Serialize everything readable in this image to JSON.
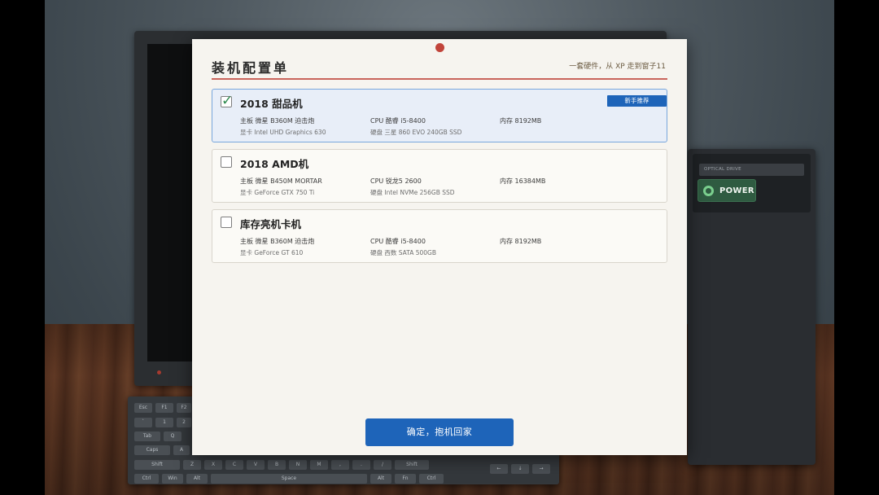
{
  "dialog": {
    "title": "装机配置单",
    "subtitle": "一套硬件，从 XP 走到窗子11",
    "confirm_label": "确定，抱机回家"
  },
  "configs": [
    {
      "name": "2018 甜品机",
      "selected": true,
      "badge": "新手推荐",
      "motherboard": "主板 微星 B360M 迫击炮",
      "gpu": "显卡 Intel UHD Graphics 630",
      "cpu": "CPU 酷睿 i5-8400",
      "disk": "硬盘 三星 860 EVO 240GB SSD",
      "memory": "内存 8192MB"
    },
    {
      "name": "2018 AMD机",
      "selected": false,
      "motherboard": "主板 微星 B450M MORTAR",
      "gpu": "显卡 GeForce GTX 750 Ti",
      "cpu": "CPU 锐龙5 2600",
      "disk": "硬盘 Intel NVMe 256GB SSD",
      "memory": "内存 16384MB"
    },
    {
      "name": "库存亮机卡机",
      "selected": false,
      "motherboard": "主板 微星 B360M 迫击炮",
      "gpu": "显卡 GeForce GT 610",
      "cpu": "CPU 酷睿 i5-8400",
      "disk": "硬盘 西数 SATA 500GB",
      "memory": "内存 8192MB"
    }
  ],
  "tower": {
    "optical_label": "OPTICAL DRIVE",
    "power_label": "POWER"
  },
  "keyboard": {
    "keys": [
      "Esc",
      "F1",
      "F2",
      "`",
      "1",
      "2",
      "Tab",
      "Q",
      "Caps",
      "A",
      "Shift",
      "Z",
      "X",
      "C",
      "V",
      "B",
      "N",
      "M",
      ",",
      ".",
      "/",
      "Shift",
      "Ctrl",
      "Win",
      "Alt",
      "Space",
      "Alt",
      "Fn",
      "Ctrl",
      "←",
      "↓",
      "→"
    ]
  },
  "colors": {
    "accent_blue": "#1e64b9",
    "selected_bg": "#e8eef8",
    "rule_red": "#c9655c",
    "power_green": "#2f5b41"
  }
}
